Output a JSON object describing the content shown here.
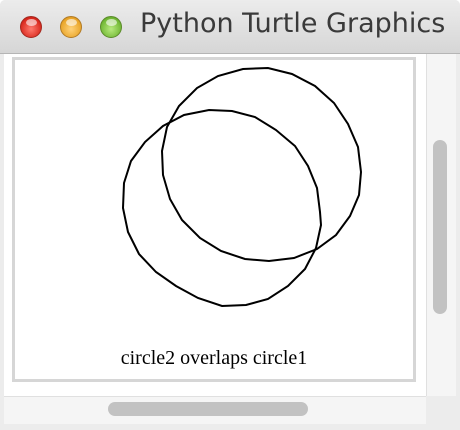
{
  "window": {
    "title": "Python Turtle Graphics",
    "buttons": [
      "close-icon",
      "minimize-icon",
      "zoom-icon"
    ]
  },
  "canvas": {
    "caption": "circle2 overlaps circle1",
    "stroke_color": "#000000",
    "background": "#ffffff",
    "shapes": [
      "circle1",
      "circle2"
    ]
  },
  "colors": {
    "close": "#e0443a",
    "minimize": "#f0a83a",
    "zoom": "#6cc04a",
    "scroll_thumb": "#c2c2c2"
  }
}
